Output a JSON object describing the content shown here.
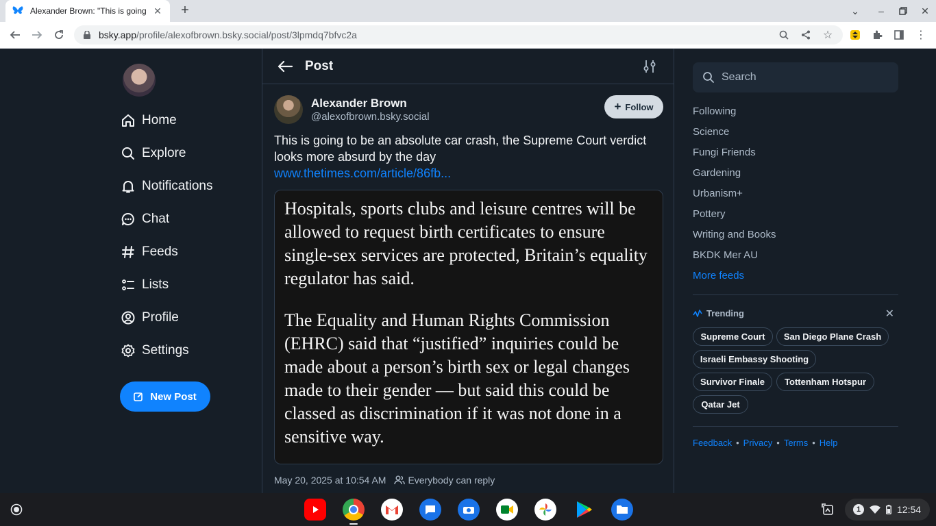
{
  "browser": {
    "tab_title": "Alexander Brown: \"This is going",
    "url_host": "bsky.app",
    "url_path": "/profile/alexofbrown.bsky.social/post/3lpmdq7bfvc2a"
  },
  "nav": {
    "items": [
      {
        "label": "Home",
        "icon": "home-icon"
      },
      {
        "label": "Explore",
        "icon": "search-icon"
      },
      {
        "label": "Notifications",
        "icon": "bell-icon"
      },
      {
        "label": "Chat",
        "icon": "chat-icon"
      },
      {
        "label": "Feeds",
        "icon": "hash-icon"
      },
      {
        "label": "Lists",
        "icon": "list-icon"
      },
      {
        "label": "Profile",
        "icon": "user-icon"
      },
      {
        "label": "Settings",
        "icon": "gear-icon"
      }
    ],
    "new_post": "New Post"
  },
  "post": {
    "header_title": "Post",
    "author_name": "Alexander Brown",
    "author_handle": "@alexofbrown.bsky.social",
    "follow_label": "Follow",
    "text": "This is going to be an absolute car crash, the Supreme Court verdict looks more absurd by the day",
    "link": "www.thetimes.com/article/86fb...",
    "embed_p1": "Hospitals, sports clubs and leisure centres will be allowed to request birth certificates to ensure single-sex services are protected, Britain’s equality regulator has said.",
    "embed_p2": "The Equality and Human Rights Commission (EHRC) said that “justified” inquiries could be made about a person’s birth sex or legal changes made to their gender — but said this could be classed as discrimination if it was not done in a sensitive way.",
    "timestamp": "May 20, 2025 at 10:54 AM",
    "reply_setting": "Everybody can reply"
  },
  "sidebar": {
    "search_placeholder": "Search",
    "feeds": [
      "Following",
      "Science",
      "Fungi Friends",
      "Gardening",
      "Urbanism+",
      "Pottery",
      "Writing and Books",
      "BKDK Mer AU"
    ],
    "more_feeds": "More feeds",
    "trending_title": "Trending",
    "trending": [
      "Supreme Court",
      "San Diego Plane Crash",
      "Israeli Embassy Shooting",
      "Survivor Finale",
      "Tottenham Hotspur",
      "Qatar Jet"
    ],
    "footer": [
      "Feedback",
      "Privacy",
      "Terms",
      "Help"
    ]
  },
  "shelf": {
    "notification_count": "1",
    "time": "12:54"
  },
  "colors": {
    "accent": "#1083fe",
    "background": "#161e27",
    "border": "#2e3c4e"
  }
}
